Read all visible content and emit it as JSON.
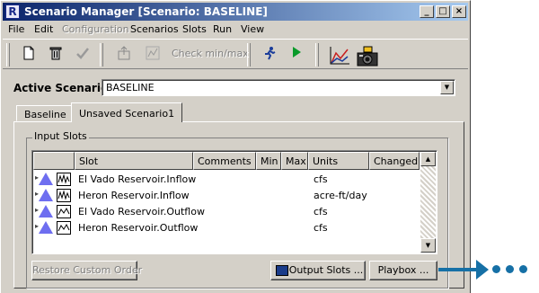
{
  "window": {
    "title": "Scenario Manager [Scenario: BASELINE]",
    "controls": [
      "_",
      "□",
      "×"
    ]
  },
  "menu": [
    "File",
    "Edit",
    "Configuration",
    "Scenarios",
    "Slots",
    "Run",
    "View"
  ],
  "toolbar": {
    "check_minmax_label": "Check min/max"
  },
  "active_scenario": {
    "label": "Active Scenario:",
    "value": "BASELINE"
  },
  "tabs": [
    {
      "label": "Baseline",
      "selected": false
    },
    {
      "label": "Unsaved Scenario1",
      "selected": true
    }
  ],
  "input_slots": {
    "title": "Input Slots",
    "columns": [
      "",
      "Slot",
      "Comments",
      "Min",
      "Max",
      "Units",
      "Changed"
    ],
    "rows": [
      {
        "slot": "El Vado Reservoir.Inflow",
        "comments": "",
        "min": "",
        "max": "",
        "units": "cfs",
        "changed": ""
      },
      {
        "slot": "Heron Reservoir.Inflow",
        "comments": "",
        "min": "",
        "max": "",
        "units": "acre-ft/day",
        "changed": ""
      },
      {
        "slot": "El Vado Reservoir.Outflow",
        "comments": "",
        "min": "",
        "max": "",
        "units": "cfs",
        "changed": ""
      },
      {
        "slot": "Heron Reservoir.Outflow",
        "comments": "",
        "min": "",
        "max": "",
        "units": "cfs",
        "changed": ""
      }
    ]
  },
  "buttons": {
    "restore": "Restore Custom Order",
    "output_slots": "Output Slots ...",
    "playbox": "Playbox ..."
  },
  "colors": {
    "accent_arrow": "#1670a6",
    "title_gradient_start": "#0a246a",
    "slot_triangle": "#6e6ef0"
  }
}
